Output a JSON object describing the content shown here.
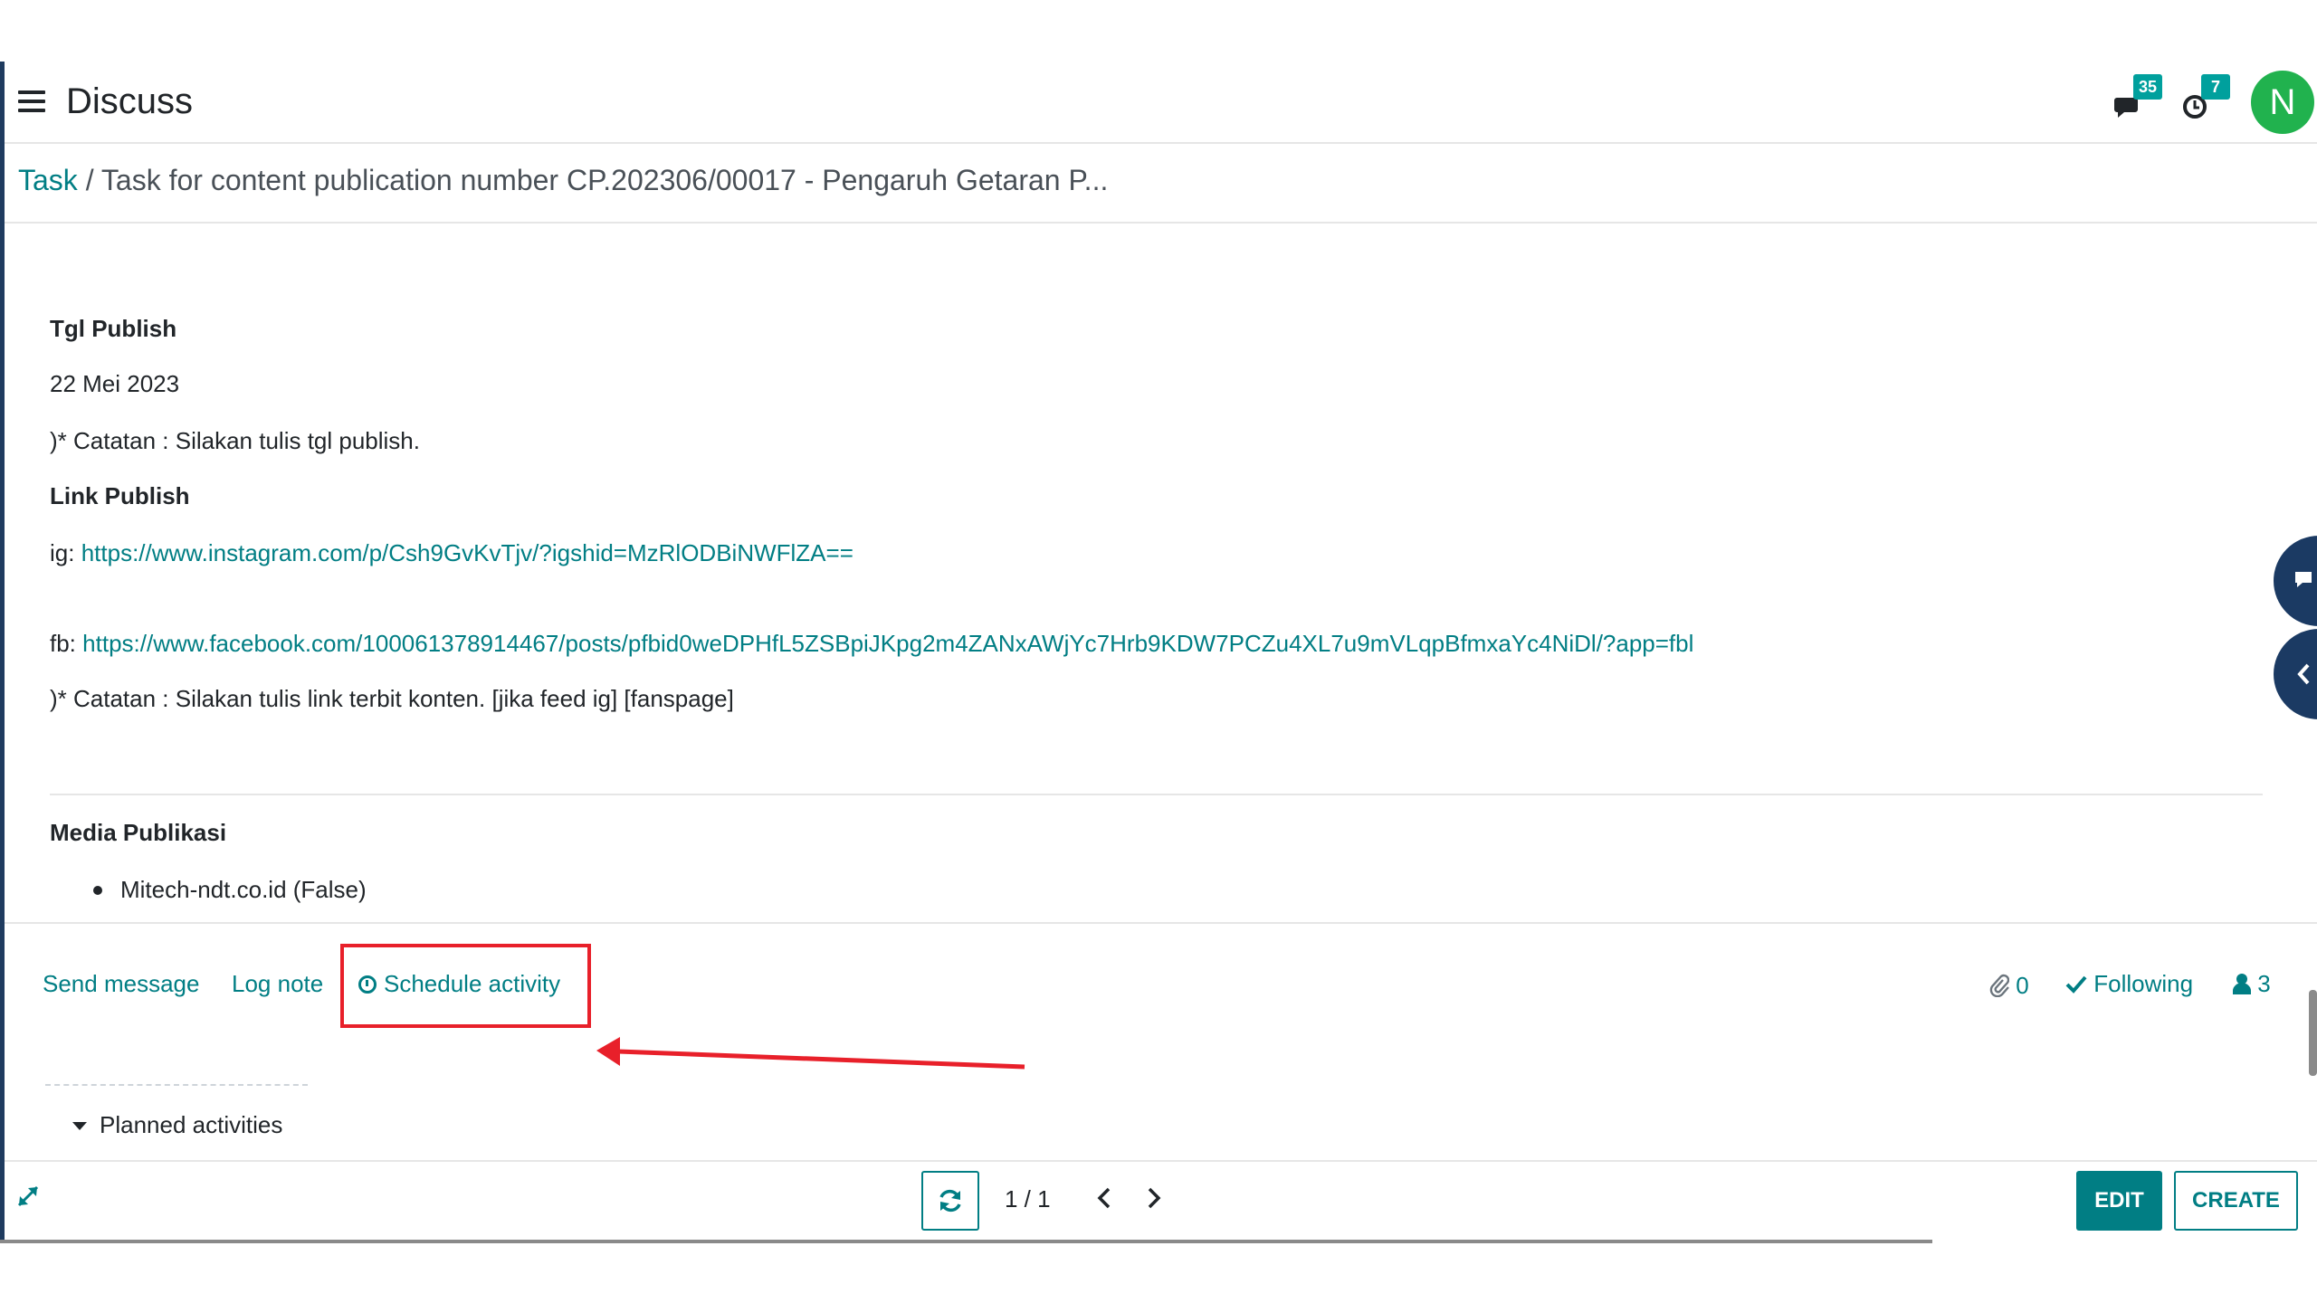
{
  "header": {
    "app_title": "Discuss",
    "messages_count": "35",
    "activities_count": "7",
    "avatar_initial": "N"
  },
  "breadcrumb": {
    "parent": "Task",
    "separator": "/",
    "current": "Task for content publication number CP.202306/00017 - Pengaruh Getaran P..."
  },
  "content": {
    "tgl_publish_heading": "Tgl Publish",
    "tgl_publish_value": "22 Mei 2023",
    "tgl_note": ")* Catatan : Silakan tulis tgl publish.",
    "link_publish_heading": "Link Publish",
    "ig_prefix": "ig:",
    "ig_link": "https://www.instagram.com/p/Csh9GvKvTjv/?igshid=MzRlODBiNWFlZA==",
    "fb_prefix": "fb:",
    "fb_link": "https://www.facebook.com/100061378914467/posts/pfbid0weDPHfL5ZSBpiJKpg2m4ZANxAWjYc7Hrb9KDW7PCZu4XL7u9mVLqpBfmxaYc4NiDl/?app=fbl",
    "link_note": ")* Catatan : Silakan tulis link terbit konten. [jika feed ig] [fanspage]",
    "media_heading": "Media Publikasi",
    "media_items": [
      "Mitech-ndt.co.id (False)"
    ]
  },
  "chatter": {
    "send_message": "Send message",
    "log_note": "Log note",
    "schedule_activity": "Schedule activity",
    "attachments_count": "0",
    "following_label": "Following",
    "followers_count": "3",
    "planned_activities": "Planned activities"
  },
  "footer": {
    "pager": "1 / 1",
    "edit_label": "EDIT",
    "create_label": "CREATE"
  },
  "colors": {
    "accent": "#017e84",
    "badge": "#00a09d",
    "avatar": "#21b24e",
    "highlight": "#e8202a",
    "side_tab": "#1b3a63"
  }
}
